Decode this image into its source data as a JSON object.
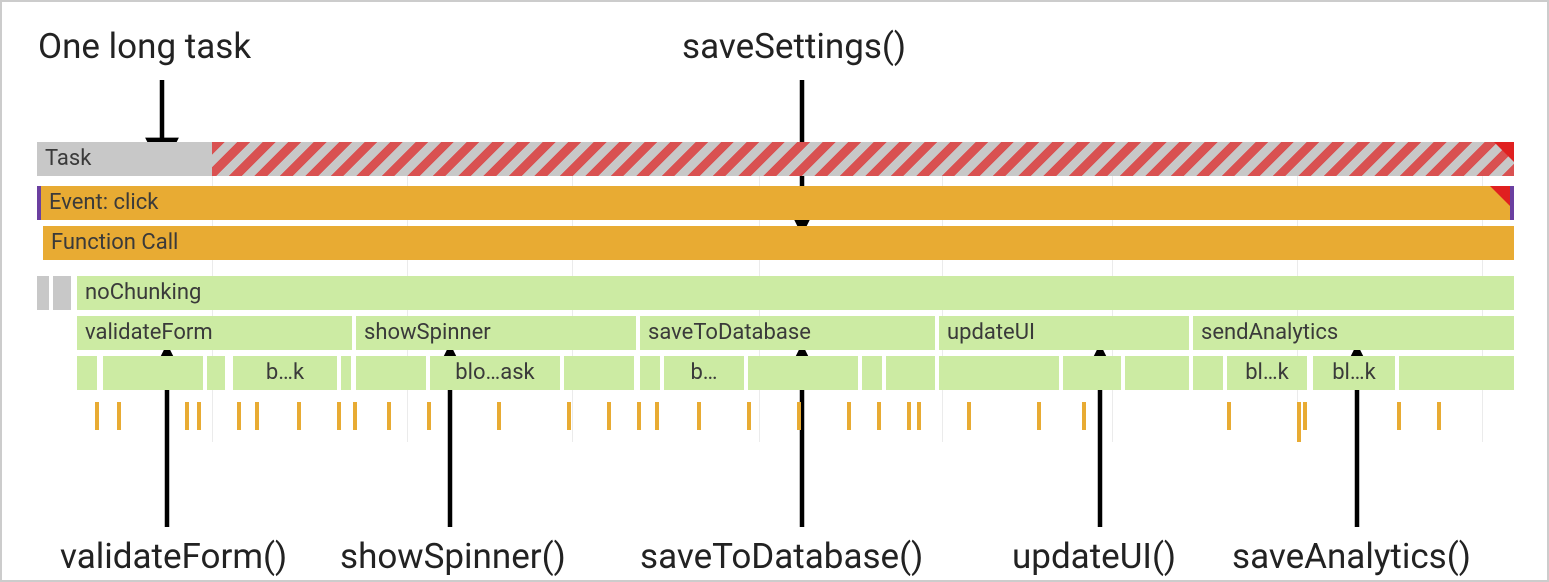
{
  "annotations": {
    "top_left": "One long task",
    "top_center": "saveSettings()",
    "bottom1": "validateForm()",
    "bottom2": "showSpinner()",
    "bottom3": "saveToDatabase()",
    "bottom4": "updateUI()",
    "bottom5": "saveAnalytics()"
  },
  "flame": {
    "task_label": "Task",
    "event_label": "Event: click",
    "fncall_label": "Function Call",
    "wrapper_label": "noChunking",
    "children": {
      "c1": "validateForm",
      "c2": "showSpinner",
      "c3": "saveToDatabase",
      "c4": "updateUI",
      "c5": "sendAnalytics"
    },
    "leaves": {
      "l1": "b…k",
      "l2": "blo…ask",
      "l3": "b…",
      "l4": "bl…k",
      "l5": "bl…k"
    }
  },
  "colors": {
    "green": "#cceba3",
    "orange": "#e8ab33",
    "grey": "#c8c8c8",
    "red": "#dc3c3c",
    "purple": "#6b3fa0"
  }
}
